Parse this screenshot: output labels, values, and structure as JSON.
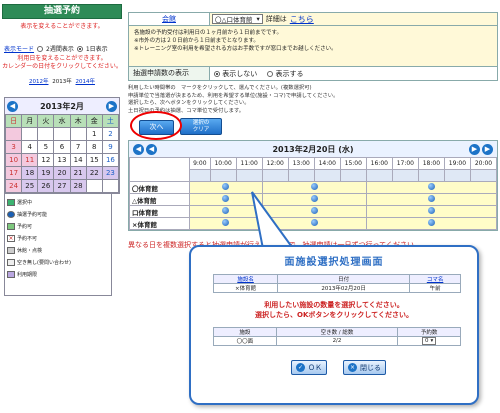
{
  "header": {
    "title": "抽選予約"
  },
  "left": {
    "hint1": "表示を変えることができます。",
    "mode_label": "表示モード",
    "mode_opt1": "2週間表示",
    "mode_opt2": "1日表示",
    "hint2a": "利用日を変えることができます。",
    "hint2b": "カレンダーの日付をクリックしてください。",
    "years": [
      "2012年",
      "2013年",
      "2014年"
    ]
  },
  "calendar": {
    "title": "2013年2月",
    "prev": "◀",
    "next": "▶",
    "weekdays": [
      "日",
      "月",
      "火",
      "水",
      "木",
      "金",
      "土"
    ],
    "rows": [
      [
        "",
        "",
        "",
        "",
        "",
        "1",
        "2"
      ],
      [
        "3",
        "4",
        "5",
        "6",
        "7",
        "8",
        "9"
      ],
      [
        "10",
        "11",
        "12",
        "13",
        "14",
        "15",
        "16"
      ],
      [
        "17",
        "18",
        "19",
        "20",
        "21",
        "22",
        "23"
      ],
      [
        "24",
        "25",
        "26",
        "27",
        "28",
        "",
        ""
      ]
    ]
  },
  "legend": {
    "items": [
      "選択中",
      "抽選予約可能",
      "予約可",
      "予約不可",
      "休館・点検",
      "空き無し(要問い合わせ)",
      "利用期限"
    ]
  },
  "info": {
    "link_label": "会館",
    "facility_select": "〇△口体育館",
    "details_prefix": "詳細は",
    "details_link": "こちら",
    "notes": [
      "各施設の予約受付は利用日の１ヶ月前から１日前までです。",
      "※市外の方は２０日前から１日前までとなります。",
      "※トレーニング室の利用を希望される方はお手数ですが窓口までお越しください。"
    ],
    "display_label": "抽選申請数の表示",
    "opt_hide": "表示しない",
    "opt_show": "表示する"
  },
  "instructions": [
    "利用したい時間帯の　マークをクリックして、選んでください。(複数選択可)",
    "申請単位で当落選が決まるため、利用を希望する単位(施設・コマ)で申請してください。",
    "選択したら、次へボタンをクリックしてください。",
    "土日祝日の予約は抽選、コマ単位で受付します。"
  ],
  "buttons": {
    "next": "次へ",
    "clear_line1": "選択の",
    "clear_line2": "クリア"
  },
  "schedule": {
    "date": "2013年2月20日 (水)",
    "times": [
      "9:00",
      "10:00",
      "11:00",
      "12:00",
      "13:00",
      "14:00",
      "15:00",
      "16:00",
      "17:00",
      "18:00",
      "19:00",
      "20:00"
    ],
    "rows": [
      {
        "name": "〇体育館"
      },
      {
        "name": "△体育館"
      },
      {
        "name": "口体育館"
      },
      {
        "name": "×体育館"
      }
    ]
  },
  "warning": "異なる日を複数選択すると抽選申請が行えませんので、抽選申請は一日ずつ行ってください。",
  "popup": {
    "title": "面施設選択処理画面",
    "col_facility": "施設名",
    "col_date": "日付",
    "col_koma": "コマ名",
    "facility": "×体育館",
    "date": "2013年02月20日",
    "koma": "午前",
    "msg1": "利用したい施設の数量を選択してください。",
    "msg2": "選択したら、OKボタンをクリックしてください。",
    "col_facility2": "施設",
    "col_availability": "空き数 / 総数",
    "col_count": "予約数",
    "row_facility": "〇〇面",
    "row_avail": "2/2",
    "row_count": "0",
    "ok": "ＯＫ",
    "close": "閉じる"
  }
}
